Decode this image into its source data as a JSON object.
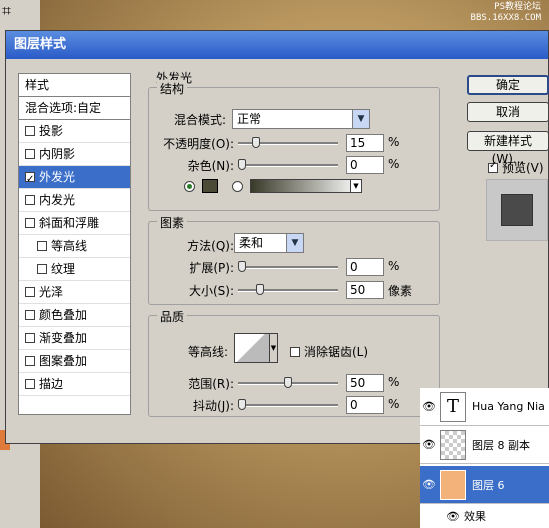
{
  "background": {
    "watermark_line1": "PS教程论坛",
    "watermark_line2": "BBS.16XX8.COM"
  },
  "dialog": {
    "title": "图层样式",
    "sidebar": {
      "header": "样式",
      "blend": "混合选项:自定",
      "items": [
        {
          "label": "投影",
          "checked": false
        },
        {
          "label": "内阴影",
          "checked": false
        },
        {
          "label": "外发光",
          "checked": true
        },
        {
          "label": "内发光",
          "checked": false
        },
        {
          "label": "斜面和浮雕",
          "checked": false
        },
        {
          "label": "等高线",
          "checked": false
        },
        {
          "label": "纹理",
          "checked": false
        },
        {
          "label": "光泽",
          "checked": false
        },
        {
          "label": "颜色叠加",
          "checked": false
        },
        {
          "label": "渐变叠加",
          "checked": false
        },
        {
          "label": "图案叠加",
          "checked": false
        },
        {
          "label": "描边",
          "checked": false
        }
      ]
    },
    "panel_title": "外发光",
    "structure": {
      "label": "结构",
      "blend_mode_label": "混合模式:",
      "blend_mode_value": "正常",
      "opacity_label": "不透明度(O):",
      "opacity_value": "15",
      "opacity_fraction": 0.15,
      "noise_label": "杂色(N):",
      "noise_value": "0",
      "noise_fraction": 0.0,
      "unit": "%"
    },
    "elements": {
      "label": "图素",
      "technique_label": "方法(Q):",
      "technique_value": "柔和",
      "spread_label": "扩展(P):",
      "spread_value": "0",
      "spread_fraction": 0.0,
      "size_label": "大小(S):",
      "size_value": "50",
      "size_fraction": 0.2,
      "size_unit": "像素",
      "unit": "%"
    },
    "quality": {
      "label": "品质",
      "contour_label": "等高线:",
      "antialias_label": "消除锯齿(L)",
      "range_label": "范围(R):",
      "range_value": "50",
      "range_fraction": 0.5,
      "jitter_label": "抖动(J):",
      "jitter_value": "0",
      "jitter_fraction": 0.0,
      "unit": "%"
    },
    "buttons": {
      "ok": "确定",
      "cancel": "取消",
      "new_style": "新建样式(W)..."
    },
    "preview_label": "预览(V)"
  },
  "layers": {
    "rows": [
      {
        "name": "Hua Yang Nia",
        "thumb": "T"
      },
      {
        "name": "图层 8 副本",
        "thumb": ""
      },
      {
        "name": "图层 6",
        "thumb": ""
      }
    ],
    "effect_label": "效果"
  }
}
